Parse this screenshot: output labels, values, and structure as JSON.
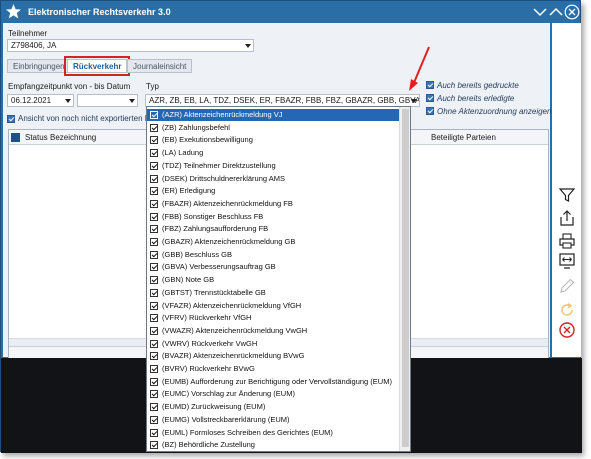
{
  "window": {
    "title": "Elektronischer Rechtsverkehr 3.0",
    "accent_color": "#2a6ea8",
    "icons": [
      "star-logo-icon",
      "minimize-chevron-icon",
      "maximize-chevron-icon",
      "close-icon"
    ]
  },
  "participant": {
    "label": "Teilnehmer",
    "value": "Z798406, JA"
  },
  "tabs": [
    {
      "label": "Einbringungen",
      "active": false
    },
    {
      "label": "Rückverkehr",
      "active": true
    },
    {
      "label": "Journaleinsicht",
      "active": false
    }
  ],
  "filters": {
    "date_label": "Empfangzeitpunkt von - bis Datum",
    "date_from": "06.12.2021",
    "date_to": "",
    "type_label": "Typ",
    "type_value": "AZR, ZB, EB, LA, TDZ, DSEK, ER, FBAZR, FBB, FBZ, GBAZR, GBB, GBVA, GBN, GBTST, VFAZR, VFRV, VWAZR, VWRV, BVAZR, BVRV, EUMB, EUMC, EUMD, EUMG, EUML, BZ",
    "unexported_label": "Ansicht von noch nicht exportierten Rü"
  },
  "options": [
    {
      "label": "Auch bereits gedruckte",
      "checked": true
    },
    {
      "label": "Auch bereits erledigte",
      "checked": true
    },
    {
      "label": "Ohne Aktenzuordnung anzeigen",
      "checked": true
    }
  ],
  "grid": {
    "columns": [
      "Status",
      "Bezeichnung",
      "Beteiligte Parteien"
    ]
  },
  "type_options": [
    {
      "label": "(AZR) Aktenzeichenrückmeldung VJ",
      "checked": true,
      "highlighted": true
    },
    {
      "label": "(ZB) Zahlungsbefehl",
      "checked": true,
      "highlighted": false
    },
    {
      "label": "(EB) Exekutionsbewilligung",
      "checked": true,
      "highlighted": false
    },
    {
      "label": "(LA) Ladung",
      "checked": true,
      "highlighted": false
    },
    {
      "label": "(TDZ) Teilnehmer Direktzustellung",
      "checked": true,
      "highlighted": false
    },
    {
      "label": "(DSEK) Drittschuldnererklärung AMS",
      "checked": true,
      "highlighted": false
    },
    {
      "label": "(ER) Erledigung",
      "checked": true,
      "highlighted": false
    },
    {
      "label": "(FBAZR) Aktenzeichenrückmeldung FB",
      "checked": true,
      "highlighted": false
    },
    {
      "label": "(FBB) Sonstiger Beschluss FB",
      "checked": true,
      "highlighted": false
    },
    {
      "label": "(FBZ) Zahlungsaufforderung FB",
      "checked": true,
      "highlighted": false
    },
    {
      "label": "(GBAZR) Aktenzeichenrückmeldung GB",
      "checked": true,
      "highlighted": false
    },
    {
      "label": "(GBB) Beschluss GB",
      "checked": true,
      "highlighted": false
    },
    {
      "label": "(GBVA) Verbesserungsauftrag GB",
      "checked": true,
      "highlighted": false
    },
    {
      "label": "(GBN) Note GB",
      "checked": true,
      "highlighted": false
    },
    {
      "label": "(GBTST) Trennstücktabelle GB",
      "checked": true,
      "highlighted": false
    },
    {
      "label": "(VFAZR) Aktenzeichenrückmeldung VfGH",
      "checked": true,
      "highlighted": false
    },
    {
      "label": "(VFRV) Rückverkehr VfGH",
      "checked": true,
      "highlighted": false
    },
    {
      "label": "(VWAZR) Aktenzeichenrückmeldung VwGH",
      "checked": true,
      "highlighted": false
    },
    {
      "label": "(VWRV) Rückverkehr VwGH",
      "checked": true,
      "highlighted": false
    },
    {
      "label": "(BVAZR) Aktenzeichenrückmeldung BVwG",
      "checked": true,
      "highlighted": false
    },
    {
      "label": "(BVRV) Rückverkehr BVwG",
      "checked": true,
      "highlighted": false
    },
    {
      "label": "(EUMB) Aufforderung zur Berichtigung oder Vervollständigung (EUM)",
      "checked": true,
      "highlighted": false
    },
    {
      "label": "(EUMC) Vorschlag zur Änderung (EUM)",
      "checked": true,
      "highlighted": false
    },
    {
      "label": "(EUMD) Zurückweisung (EUM)",
      "checked": true,
      "highlighted": false
    },
    {
      "label": "(EUMG) Vollstreckbarerklärung (EUM)",
      "checked": true,
      "highlighted": false
    },
    {
      "label": "(EUML) Formloses Schreiben des Gerichtes (EUM)",
      "checked": true,
      "highlighted": false
    },
    {
      "label": "(BZ) Behördliche Zustellung",
      "checked": true,
      "highlighted": false
    }
  ],
  "toolbar": {
    "icons": [
      "filter-icon",
      "export-icon",
      "print-icon",
      "fit-width-icon",
      "edit-pencil-icon",
      "refresh-icon",
      "delete-icon"
    ]
  },
  "annotation": {
    "arrow_color": "#e02020"
  }
}
